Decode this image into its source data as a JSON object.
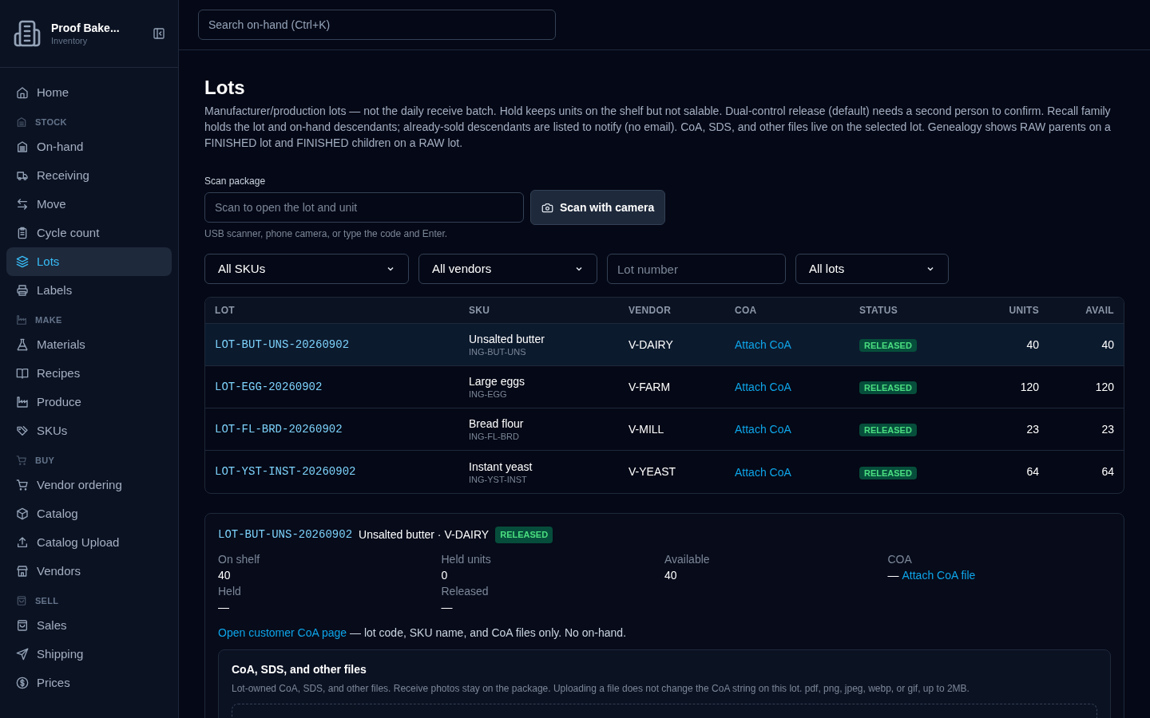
{
  "sidebar": {
    "brand": {
      "name": "Proof Bake...",
      "subtitle": "Inventory"
    },
    "nav": [
      {
        "kind": "item",
        "label": "Home",
        "selected": false
      },
      {
        "kind": "section",
        "label": "STOCK"
      },
      {
        "kind": "item",
        "label": "On-hand",
        "selected": false
      },
      {
        "kind": "item",
        "label": "Receiving",
        "selected": false
      },
      {
        "kind": "item",
        "label": "Move",
        "selected": false
      },
      {
        "kind": "item",
        "label": "Cycle count",
        "selected": false
      },
      {
        "kind": "item",
        "label": "Lots",
        "selected": true
      },
      {
        "kind": "item",
        "label": "Labels",
        "selected": false
      },
      {
        "kind": "section",
        "label": "MAKE"
      },
      {
        "kind": "item",
        "label": "Materials",
        "selected": false
      },
      {
        "kind": "item",
        "label": "Recipes",
        "selected": false
      },
      {
        "kind": "item",
        "label": "Produce",
        "selected": false
      },
      {
        "kind": "item",
        "label": "SKUs",
        "selected": false
      },
      {
        "kind": "section",
        "label": "BUY"
      },
      {
        "kind": "item",
        "label": "Vendor ordering",
        "selected": false
      },
      {
        "kind": "item",
        "label": "Catalog",
        "selected": false
      },
      {
        "kind": "item",
        "label": "Catalog Upload",
        "selected": false
      },
      {
        "kind": "item",
        "label": "Vendors",
        "selected": false
      },
      {
        "kind": "section",
        "label": "SELL"
      },
      {
        "kind": "item",
        "label": "Sales",
        "selected": false
      },
      {
        "kind": "item",
        "label": "Shipping",
        "selected": false
      },
      {
        "kind": "item",
        "label": "Prices",
        "selected": false
      }
    ]
  },
  "search": {
    "placeholder": "Search on-hand (Ctrl+K)"
  },
  "page": {
    "title": "Lots",
    "description": "Manufacturer/production lots — not the daily receive batch. Hold keeps units on the shelf but not salable. Dual-control release (default) needs a second person to confirm. Recall family holds the lot and on-hand descendants; already-sold descendants are listed to notify (no email). CoA, SDS, and other files live on the selected lot. Genealogy shows RAW parents on a FINISHED lot and FINISHED children on a RAW lot."
  },
  "scan": {
    "label": "Scan package",
    "placeholder": "Scan to open the lot and unit",
    "button": "Scan with camera",
    "hint": "USB scanner, phone camera, or type the code and Enter."
  },
  "filters": [
    {
      "kind": "select",
      "value": "All SKUs"
    },
    {
      "kind": "select",
      "value": "All vendors"
    },
    {
      "kind": "input",
      "placeholder": "Lot number"
    },
    {
      "kind": "select",
      "value": "All lots"
    }
  ],
  "table": {
    "columns": [
      "LOT",
      "SKU",
      "VENDOR",
      "COA",
      "STATUS",
      "UNITS",
      "AVAIL"
    ],
    "rows": [
      {
        "lot": "LOT-BUT-UNS-20260902",
        "sku": "Unsalted butter",
        "sku_code": "ING-BUT-UNS",
        "vendor": "V-DAIRY",
        "coa": "Attach CoA",
        "status": "RELEASED",
        "units": "40",
        "avail": "40",
        "selected": true
      },
      {
        "lot": "LOT-EGG-20260902",
        "sku": "Large eggs",
        "sku_code": "ING-EGG",
        "vendor": "V-FARM",
        "coa": "Attach CoA",
        "status": "RELEASED",
        "units": "120",
        "avail": "120",
        "selected": false
      },
      {
        "lot": "LOT-FL-BRD-20260902",
        "sku": "Bread flour",
        "sku_code": "ING-FL-BRD",
        "vendor": "V-MILL",
        "coa": "Attach CoA",
        "status": "RELEASED",
        "units": "23",
        "avail": "23",
        "selected": false
      },
      {
        "lot": "LOT-YST-INST-20260902",
        "sku": "Instant yeast",
        "sku_code": "ING-YST-INST",
        "vendor": "V-YEAST",
        "coa": "Attach CoA",
        "status": "RELEASED",
        "units": "64",
        "avail": "64",
        "selected": false
      }
    ]
  },
  "detail": {
    "lot": "LOT-BUT-UNS-20260902",
    "title": "Unsalted butter · V-DAIRY",
    "status": "RELEASED",
    "stats": [
      {
        "label": "On shelf",
        "value": "40"
      },
      {
        "label": "Held units",
        "value": "0"
      },
      {
        "label": "Available",
        "value": "40"
      },
      {
        "label": "COA",
        "value": "—",
        "link": "Attach CoA file"
      },
      {
        "label": "Held",
        "value": "—"
      },
      {
        "label": "Released",
        "value": "—"
      }
    ],
    "customer_link": "Open customer CoA page",
    "customer_note": "— lot code, SKU name, and CoA files only. No on-hand.",
    "files": {
      "title": "CoA, SDS, and other files",
      "description": "Lot-owned CoA, SDS, and other files. Receive photos stay on the package. Uploading a file does not change the CoA string on this lot. pdf, png, jpeg, webp, or gif, up to 2MB."
    }
  }
}
